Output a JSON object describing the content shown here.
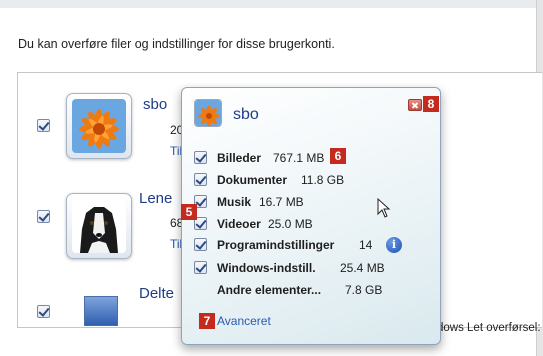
{
  "intro_text": "Du kan overføre filer og indstillinger for disse brugerkonti.",
  "footer_fragment": "dows Let overførsel:",
  "accounts": [
    {
      "name": "sbo",
      "size_fragment": "20",
      "link_fragment": "Til"
    },
    {
      "name": "Lene",
      "size_fragment": "68",
      "link_fragment": "Til"
    },
    {
      "name": "Delte",
      "size_fragment": "",
      "link_fragment": ""
    }
  ],
  "popup": {
    "user_name": "sbo",
    "items": [
      {
        "label": "Billeder",
        "size": "767.1 MB",
        "checked": true
      },
      {
        "label": "Dokumenter",
        "size": "11.8 GB",
        "checked": true
      },
      {
        "label": "Musik",
        "size": "16.7 MB",
        "checked": true
      },
      {
        "label": "Videoer",
        "size": "25.0 MB",
        "checked": true
      },
      {
        "label": "Programindstillinger",
        "size": "14",
        "checked": true,
        "info_icon": "info-icon"
      },
      {
        "label": "Windows-indstill.",
        "size": "25.4 MB",
        "checked": true
      },
      {
        "label": "Andre elementer...",
        "size": "7.8 GB",
        "checked": false
      }
    ],
    "advanced_link": "Avanceret"
  },
  "badges": {
    "b5": "5",
    "b6": "6",
    "b7": "7",
    "b8": "8"
  },
  "colors": {
    "badge": "#c52a1f",
    "link": "#2a59b3",
    "name": "#1f3c88"
  }
}
